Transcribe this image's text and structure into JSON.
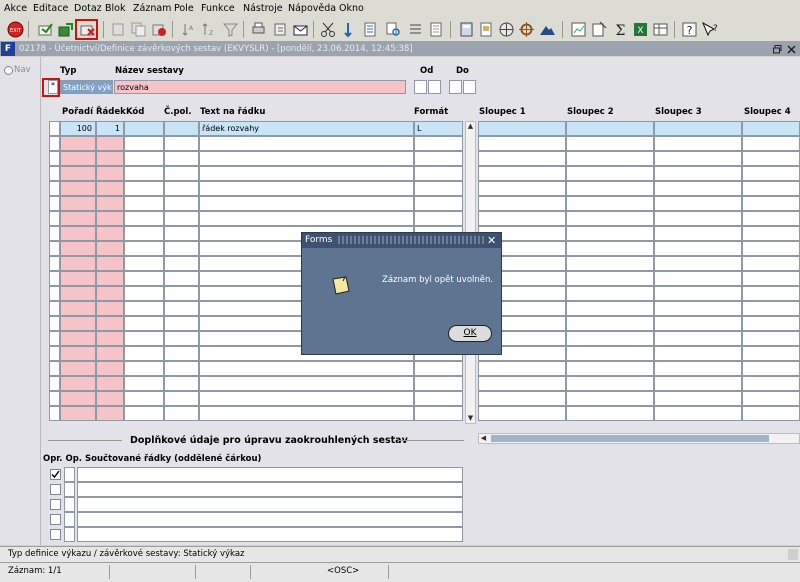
{
  "menu": [
    "Akce",
    "Editace",
    "Dotaz",
    "Blok",
    "Záznam",
    "Pole",
    "Funkce",
    "Nástroje",
    "Nápověda",
    "Okno"
  ],
  "window": {
    "title": "02178 - Účetnictví/Definice závěrkových sestav (EKVYSLR) - [pondělí, 23.06.2014, 12:45:38]"
  },
  "nav": {
    "label": "Nav"
  },
  "header": {
    "typ_label": "Typ",
    "nazev_label": "Název sestavy",
    "od_label": "Od",
    "do_label": "Do",
    "typ_value": "Statický výka",
    "nazev_value": "rozvaha",
    "row_marker": "*"
  },
  "grid": {
    "columns": {
      "poradi": "Pořadí",
      "radek": "Řádek",
      "kod": "Kód",
      "cpol": "Č.pol.",
      "text": "Text na řádku",
      "format": "Formát",
      "s1": "Sloupec 1",
      "s2": "Sloupec 2",
      "s3": "Sloupec 3",
      "s4": "Sloupec 4"
    },
    "row1": {
      "poradi": "100",
      "radek": "1",
      "text": "řádek rozvahy",
      "format": "L"
    }
  },
  "section": {
    "title": "Doplňkové údaje pro úpravu zaokrouhlených sestav",
    "cols": "Opr. Op. Součtované řádky (oddělené čárkou)"
  },
  "dialog": {
    "title": "Forms",
    "message": "Záznam byl opět uvolněn.",
    "ok": "OK"
  },
  "status": {
    "hint": "Typ definice výkazu / závěrkové sestavy: Statický výkaz",
    "record": "Záznam: 1/1",
    "mode": "<OSC>"
  },
  "colors": {
    "pink": "#f6c3c9",
    "blue": "#c9e3f7",
    "dialog": "#5e7491",
    "highlight_border": "#cc1111"
  }
}
